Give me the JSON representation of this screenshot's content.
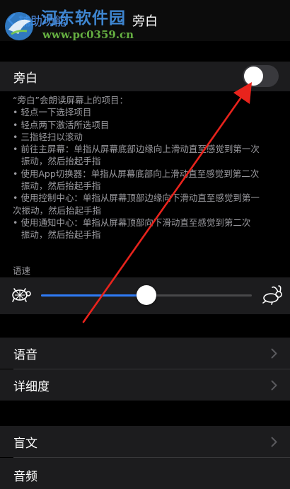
{
  "navbar": {
    "back_label": "辅助功能",
    "title": "旁白"
  },
  "watermark": {
    "site_name": "河东软件园",
    "url": "www.pc0359.cn"
  },
  "voiceover": {
    "label": "旁白",
    "enabled": false
  },
  "description": {
    "intro": "“旁白”会朗读屏幕上的项目：",
    "lines": [
      "•  轻点一下选择项目",
      "•  轻点两下激活所选项目",
      "•  三指轻扫以滚动",
      "•  前往主屏幕：单指从屏幕底部边缘向上滑动直至感觉到第一次",
      "   振动，然后抬起手指",
      "•  使用App切换器：单指从屏幕底部向上滑动直至感觉到第二次",
      "   振动，然后抬起手指",
      "•  使用控制中心：单指从屏幕顶部边缘向下滑动直至感觉到第一",
      "次振动，然后抬起手指",
      "•  使用通知中心：单指从屏幕顶部向下滑动直至感觉到第二次",
      "   振动，然后抬起手指"
    ]
  },
  "speaking_rate": {
    "caption": "语速",
    "value_fraction": 0.5,
    "slow_icon": "turtle-icon",
    "fast_icon": "rabbit-icon"
  },
  "menu_group_1": [
    {
      "label": "语音"
    },
    {
      "label": "详细度"
    }
  ],
  "menu_group_2": [
    {
      "label": "盲文"
    },
    {
      "label": "音频"
    }
  ],
  "colors": {
    "accent": "#2f7bf6",
    "annotation_arrow": "#e8231c",
    "background": "#000000",
    "cell": "#1c1c1e"
  }
}
